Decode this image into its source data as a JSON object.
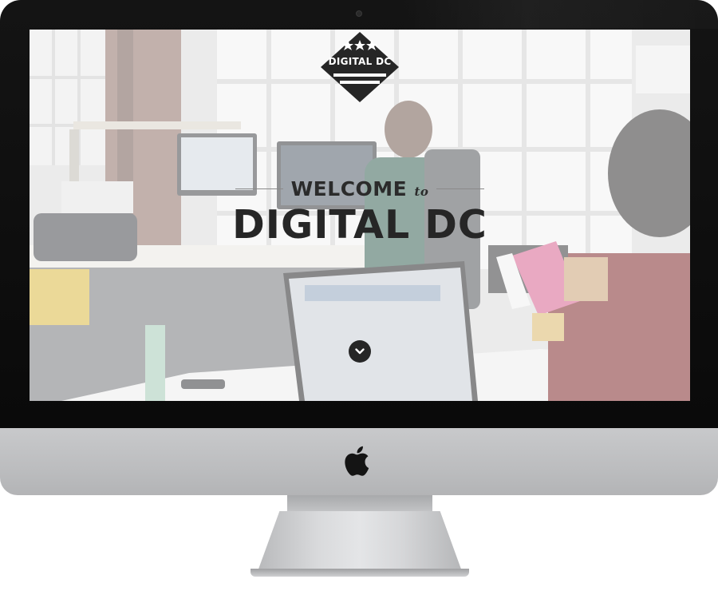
{
  "site": {
    "logo_text": "DIGITAL DC",
    "welcome_text": "WELCOME",
    "welcome_connector": "to",
    "headline": "DIGITAL DC"
  },
  "icons": {
    "logo": "diamond-stars-stripes-logo",
    "scroll": "chevron-down-icon",
    "brand": "apple-logo"
  },
  "colors": {
    "text_dark": "#262626",
    "bezel": "#111111",
    "chin": "#c3c4c6"
  }
}
